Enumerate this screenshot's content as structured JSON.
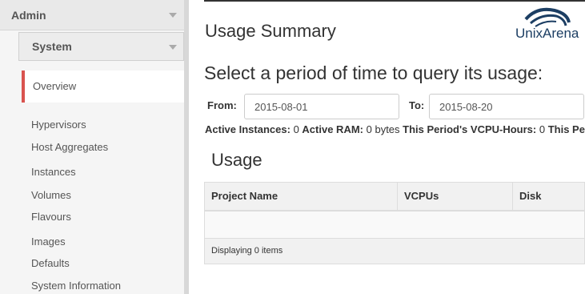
{
  "sidebar": {
    "admin_label": "Admin",
    "system_label": "System",
    "active_item": "Overview",
    "items": [
      {
        "label": "Hypervisors"
      },
      {
        "label": "Host Aggregates"
      },
      {
        "label": "Instances"
      },
      {
        "label": "Volumes"
      },
      {
        "label": "Flavours"
      },
      {
        "label": "Images"
      },
      {
        "label": "Defaults"
      },
      {
        "label": "System Information"
      }
    ]
  },
  "header": {
    "title": "Usage Summary",
    "logo_text": "UnixArena"
  },
  "period": {
    "heading": "Select a period of time to query its usage:",
    "from_label": "From:",
    "from_value": "2015-08-01",
    "to_label": "To:",
    "to_value": "2015-08-20"
  },
  "stats": {
    "instances_label": "Active Instances:",
    "instances_value": "0",
    "ram_label": "Active RAM:",
    "ram_value": "0 bytes",
    "vcpu_label": "This Period's VCPU-Hours:",
    "vcpu_value": "0",
    "trailing": "This Pe"
  },
  "usage": {
    "heading": "Usage",
    "columns": [
      "Project Name",
      "VCPUs",
      "Disk"
    ],
    "footer": "Displaying 0 items"
  },
  "colors": {
    "active_border": "#d9534f",
    "logo": "#1c3e63"
  }
}
